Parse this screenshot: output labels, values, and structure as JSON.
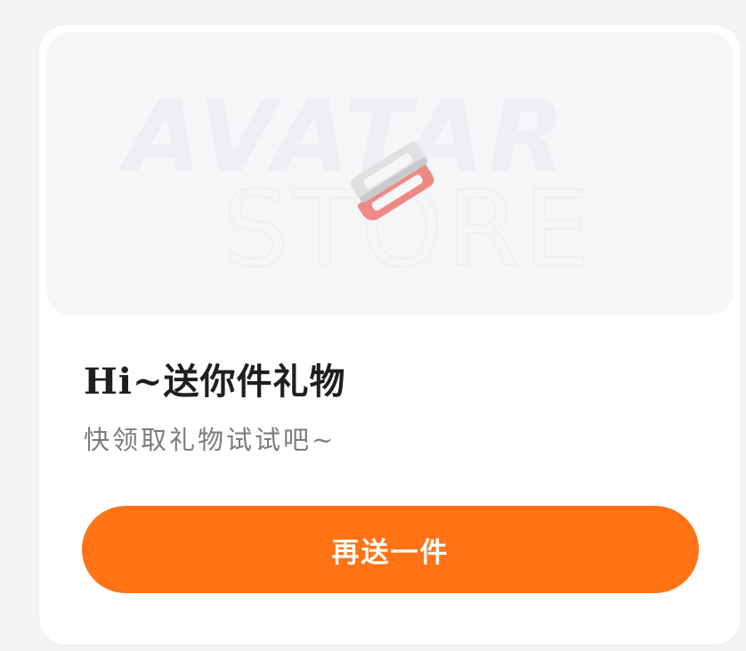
{
  "banner": {
    "watermark_line1": "AVATAR",
    "watermark_line2": "STORE",
    "icon": "hair-clip-icon"
  },
  "gift": {
    "title": "Hi~送你件礼物",
    "subtitle": "快领取礼物试试吧~"
  },
  "actions": {
    "send_again_label": "再送一件"
  },
  "colors": {
    "accent": "#ff7315",
    "background": "#f3f4f5",
    "card": "#ffffff",
    "banner": "#f6f6f9",
    "clip_gray": "#e0e0e2",
    "clip_pink": "#ee8a86"
  }
}
